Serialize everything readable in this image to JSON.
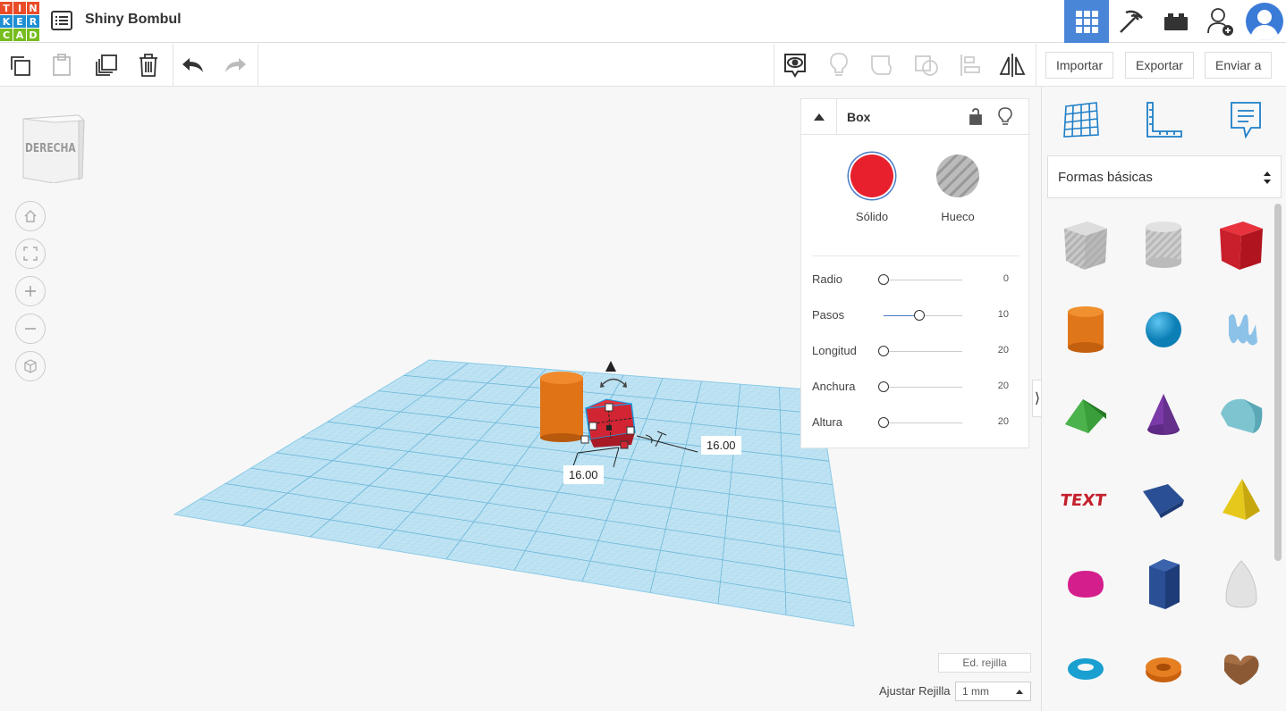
{
  "app": {
    "logo_letters": [
      "T",
      "I",
      "N",
      "K",
      "E",
      "R",
      "C",
      "A",
      "D"
    ],
    "logo_colors": [
      "#e94d28",
      "#e94d28",
      "#e94d28",
      "#1e8fd4",
      "#1e8fd4",
      "#1e8fd4",
      "#76bd1d",
      "#76bd1d",
      "#76bd1d"
    ],
    "project_title": "Shiny Bombul",
    "accent_color": "#4a86d8"
  },
  "topbar": {
    "icons": [
      "grid-view-icon",
      "pickaxe-icon",
      "bricks-icon",
      "add-user-icon",
      "avatar"
    ]
  },
  "toolbar": {
    "import_label": "Importar",
    "export_label": "Exportar",
    "send_label": "Enviar a"
  },
  "viewcube": {
    "face_label": "DERECHA"
  },
  "dimensions": {
    "width_value": "16.00",
    "depth_value": "16.00"
  },
  "inspector": {
    "title": "Box",
    "solid_label": "Sólido",
    "hole_label": "Hueco",
    "solid_color": "#e8202e",
    "properties": [
      {
        "name": "Radio",
        "value": "0",
        "fraction": 0.0
      },
      {
        "name": "Pasos",
        "value": "10",
        "fraction": 0.45
      },
      {
        "name": "Longitud",
        "value": "20",
        "fraction": 0.0
      },
      {
        "name": "Anchura",
        "value": "20",
        "fraction": 0.0
      },
      {
        "name": "Altura",
        "value": "20",
        "fraction": 0.0
      }
    ]
  },
  "grid": {
    "edit_grid_label": "Ed. rejilla",
    "snap_label": "Ajustar Rejilla",
    "snap_value": "1 mm"
  },
  "library": {
    "category": "Formas básicas",
    "shapes": [
      "box-hole",
      "cylinder-hole",
      "box",
      "cylinder",
      "sphere",
      "scribble",
      "roof",
      "cone",
      "round-roof",
      "text",
      "half-cylinder",
      "pyramid",
      "half-sphere",
      "polygon",
      "paraboloid",
      "torus",
      "tube",
      "heart"
    ]
  }
}
